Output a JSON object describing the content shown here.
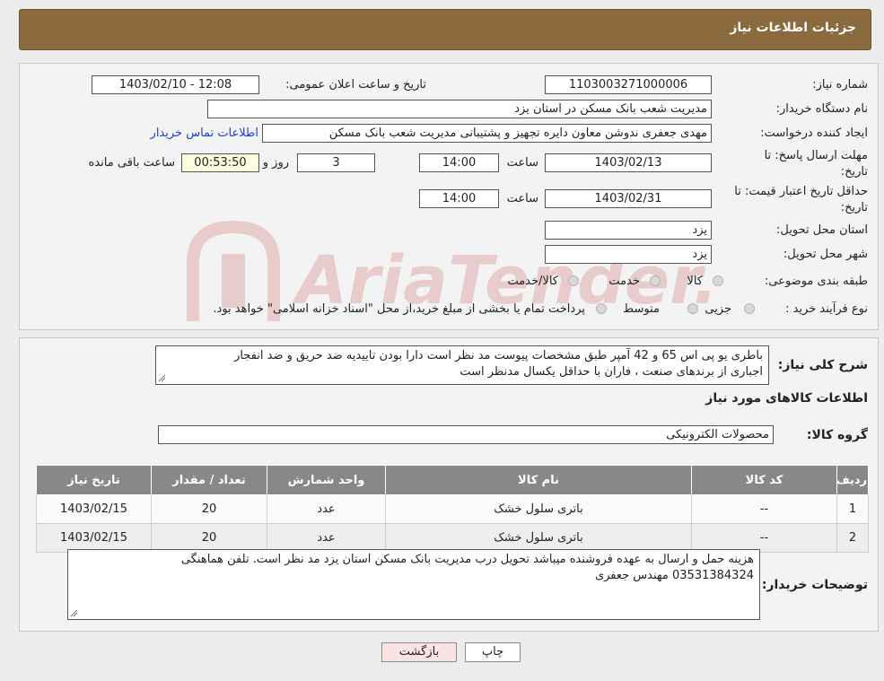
{
  "header": {
    "title": "جزئیات اطلاعات نیاز"
  },
  "form": {
    "need_number_label": "شماره نیاز:",
    "need_number": "1103003271000006",
    "announce_label": "تاریخ و ساعت اعلان عمومی:",
    "announce_value": "1403/02/10 - 12:08",
    "buyer_org_label": "نام دستگاه خریدار:",
    "buyer_org": "مدیریت شعب بانک مسکن در استان یزد",
    "requester_label": "ایجاد کننده درخواست:",
    "requester": "مهدی  جعفری ندوشن معاون دایره تجهیز و پشتیبانی مدیریت شعب بانک مسکن",
    "contact_link": "اطلاعات تماس خریدار",
    "deadline_label_1": "مهلت ارسال پاسخ: تا",
    "deadline_label_2": "تاریخ:",
    "deadline_date": "1403/02/13",
    "hour_label": "ساعت",
    "deadline_time": "14:00",
    "days_value": "3",
    "days_label": "روز و",
    "remaining_time": "00:53:50",
    "remaining_label": "ساعت باقی مانده",
    "validity_label_1": "حداقل تاریخ اعتبار قیمت: تا",
    "validity_label_2": "تاریخ:",
    "validity_date": "1403/02/31",
    "validity_hour_label": "ساعت",
    "validity_time": "14:00",
    "province_label": "استان محل تحویل:",
    "province": "یزد",
    "city_label": "شهر محل تحویل:",
    "city": "یزد",
    "category_label": "طبقه بندی موضوعی:",
    "category_options": [
      "کالا",
      "خدمت",
      "کالا/خدمت"
    ],
    "process_label": "نوع فرآیند خرید :",
    "process_options": [
      "جزیی",
      "متوسط"
    ],
    "process_note": "پرداخت تمام یا بخشی از مبلغ خرید،از محل \"اسناد خزانه اسلامی\" خواهد بود."
  },
  "details": {
    "summary_label": "شرح کلی نیاز:",
    "summary_line1": "باطری یو پی اس 65 و 42 آمپر طبق مشخصات پیوست مد نظر است دارا بودن تاییدیه ضد حریق و ضد انفجار",
    "summary_line2": "اجباری از برندهای صنعت ، فاران با حداقل یکسال مدنظر است",
    "goods_info_title": "اطلاعات کالاهای مورد نیاز",
    "goods_group_label": "گروه کالا:",
    "goods_group": "محصولات الکترونیکی",
    "table": {
      "headers": [
        "ردیف",
        "کد کالا",
        "نام کالا",
        "واحد شمارش",
        "تعداد / مقدار",
        "تاریخ نیاز"
      ],
      "rows": [
        [
          "1",
          "--",
          "باتری سلول خشک",
          "عدد",
          "20",
          "1403/02/15"
        ],
        [
          "2",
          "--",
          "باتری سلول خشک",
          "عدد",
          "20",
          "1403/02/15"
        ]
      ]
    },
    "buyer_notes_label": "توضیحات خریدار:",
    "buyer_notes_line1": "هزینه حمل و ارسال به عهده فروشنده میباشد تحویل درب مدیریت بانک مسکن استان یزد مد نظر است. تلفن هماهنگی",
    "buyer_notes_line2": "03531384324 مهندس جعفری"
  },
  "buttons": {
    "print": "چاپ",
    "back": "بازگشت"
  },
  "watermark": {
    "text": "AriaTender.neT"
  },
  "colors": {
    "header_bg": "#8b6a3e",
    "table_header_bg": "#888888",
    "link": "#1a3fd6",
    "back_button_bg": "#fbe3e3"
  }
}
